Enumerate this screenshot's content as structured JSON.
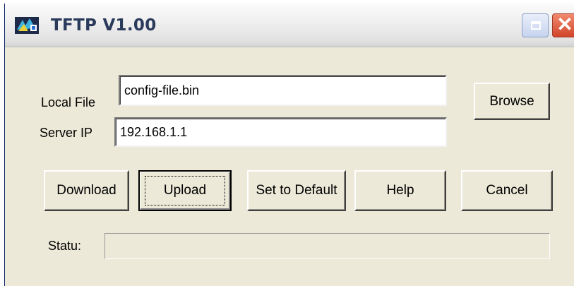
{
  "window": {
    "title": "TFTP V1.00",
    "icon": "tftp-app-icon"
  },
  "titlebar_buttons": {
    "restore_icon": "restore-icon",
    "close_glyph": "✕"
  },
  "form": {
    "local_file": {
      "label": "Local File",
      "value": "config-file.bin"
    },
    "server_ip": {
      "label": "Server IP",
      "value": "192.168.1.1"
    }
  },
  "buttons": {
    "browse": "Browse",
    "download": "Download",
    "upload": "Upload",
    "set_default": "Set to Default",
    "help": "Help",
    "cancel": "Cancel"
  },
  "status": {
    "label": "Statu:",
    "value": ""
  },
  "colors": {
    "face": "#ece9d8",
    "close_button": "#d2452b",
    "title_text": "#2a3a5a"
  }
}
